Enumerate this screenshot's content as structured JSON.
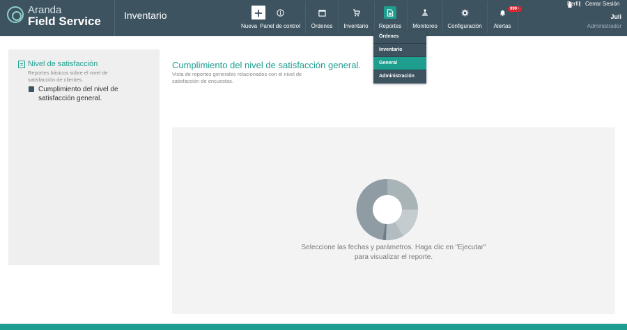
{
  "header": {
    "brand_top": "Aranda",
    "brand_bottom": "Field Service",
    "section_title": "Inventario",
    "nav": [
      {
        "label": "Nueva",
        "icon": "plus-icon"
      },
      {
        "label": "Panel de control",
        "icon": "info-icon"
      },
      {
        "label": "Órdenes",
        "icon": "calendar-icon"
      },
      {
        "label": "Inventario",
        "icon": "inventory-icon"
      },
      {
        "label": "Reportes",
        "icon": "report-icon"
      },
      {
        "label": "Monitoreo",
        "icon": "monitor-icon"
      },
      {
        "label": "Configuración",
        "icon": "gear-icon"
      },
      {
        "label": "Alertas",
        "icon": "bell-icon",
        "badge": "999+"
      }
    ],
    "perfil": "Perfil",
    "separator": "|",
    "cerrar_sesion": "Cerrar Sesión",
    "user_name": "Juli",
    "user_role": "Administrador"
  },
  "dropdown": {
    "items": [
      "Órdenes",
      "Inventario",
      "General",
      "Administración"
    ],
    "selected": "General"
  },
  "sidebar": {
    "title": "Nivel de satisfacción",
    "description": "Reportes básicos sobre el nivel de satisfacción de clientes.",
    "sub_item": "Cumplimiento del nivel de satisfacción general."
  },
  "main": {
    "title": "Cumplimiento del nivel de satisfacción general.",
    "description": "Vista de reportes generales relacionados con el nivel de satisfacción de encuestas.",
    "message_line1": "Seleccione las fechas y parámetros. Haga clic en \"Ejecutar\"",
    "message_line2": "para visualizar el reporte."
  },
  "colors": {
    "header_bg": "#3d5360",
    "accent": "#1e9e8f",
    "badge": "#e3232f",
    "panel_bg": "#efefef"
  }
}
